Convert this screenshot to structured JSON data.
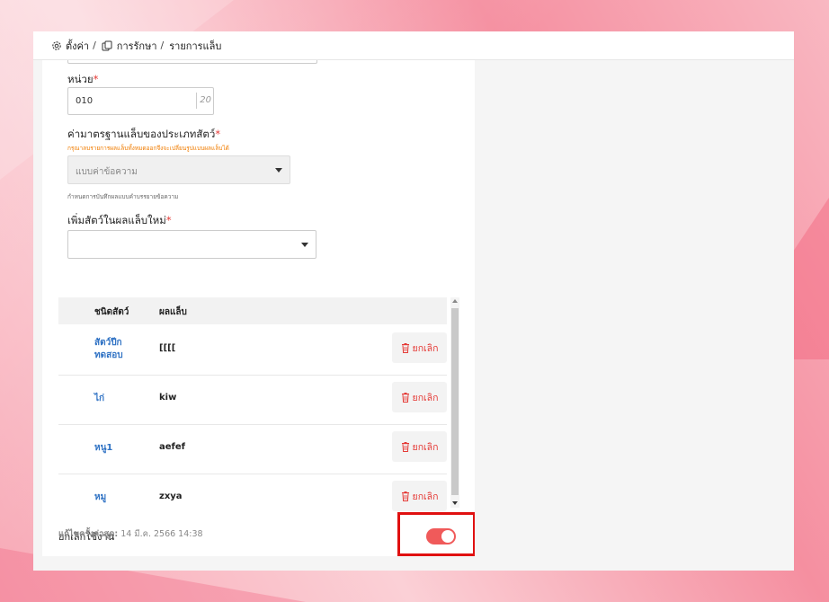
{
  "breadcrumb": {
    "items": [
      "ตั้งค่า",
      "การรักษา",
      "รายการแล็บ"
    ],
    "separator": "/"
  },
  "form": {
    "unit": {
      "label": "หน่วย",
      "required_mark": "*",
      "value": "010",
      "counter": "20"
    },
    "standard": {
      "label": "ค่ามาตรฐานแล็บของประเภทสัตว์",
      "required_mark": "*",
      "hint_orange": "กรุณาลบรายการผลแล็บทั้งหมดออกจึงจะเปลี่ยนรูปแบบผลแล็บได้",
      "select_value": "แบบค่าข้อความ",
      "hint_grey": "กำหนดการบันทึกผลแบบคำบรรยายข้อความ"
    },
    "add_animal": {
      "label": "เพิ่มสัตว์ในผลแล็บใหม่",
      "required_mark": "*",
      "value": ""
    }
  },
  "table": {
    "headers": [
      "ชนิดสัตว์",
      "ผลแล็บ"
    ],
    "rows": [
      {
        "animal": "สัตว์ปีก ทดสอบ",
        "result": "[[[[",
        "action": "ยกเลิก"
      },
      {
        "animal": "ไก่",
        "result": "kiw",
        "action": "ยกเลิก"
      },
      {
        "animal": "หนู1",
        "result": "aefef",
        "action": "ยกเลิก"
      },
      {
        "animal": "หมู",
        "result": "zxya",
        "action": "ยกเลิก"
      }
    ]
  },
  "disable_toggle": {
    "label": "ยกเลิกใช้งาน",
    "on": true,
    "color": "#f05a5a"
  },
  "last_edited": {
    "label": "แก้ไขครั้งล่าสุด:",
    "value": "14 มี.ค. 2566 14:38"
  },
  "colors": {
    "required": "#e53935",
    "link": "#2f72c4",
    "warning": "#f07c00",
    "highlight": "#e01010"
  },
  "icons": {
    "settings": "gear-icon",
    "treatment": "copy-icon",
    "delete": "trash-icon"
  }
}
